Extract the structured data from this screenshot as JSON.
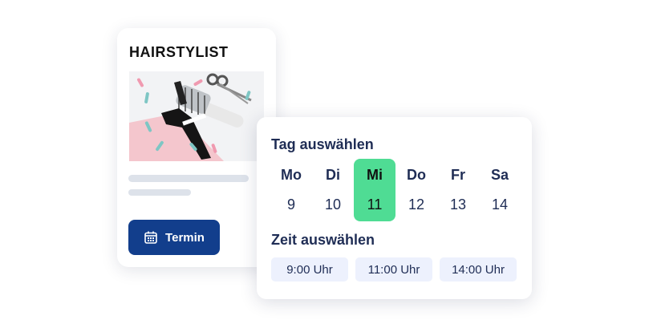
{
  "card": {
    "title": "HAIRSTYLIST",
    "button_label": "Termin",
    "button_icon": "calendar-icon",
    "button_color": "#123e8c"
  },
  "picker": {
    "day_heading": "Tag auswählen",
    "time_heading": "Zeit auswählen",
    "selected_color": "#4fdc94",
    "days": [
      {
        "name": "Mo",
        "date": "9",
        "selected": false
      },
      {
        "name": "Di",
        "date": "10",
        "selected": false
      },
      {
        "name": "Mi",
        "date": "11",
        "selected": true
      },
      {
        "name": "Do",
        "date": "12",
        "selected": false
      },
      {
        "name": "Fr",
        "date": "13",
        "selected": false
      },
      {
        "name": "Sa",
        "date": "14",
        "selected": false
      }
    ],
    "times": [
      "9:00 Uhr",
      "11:00 Uhr",
      "14:00 Uhr"
    ]
  }
}
